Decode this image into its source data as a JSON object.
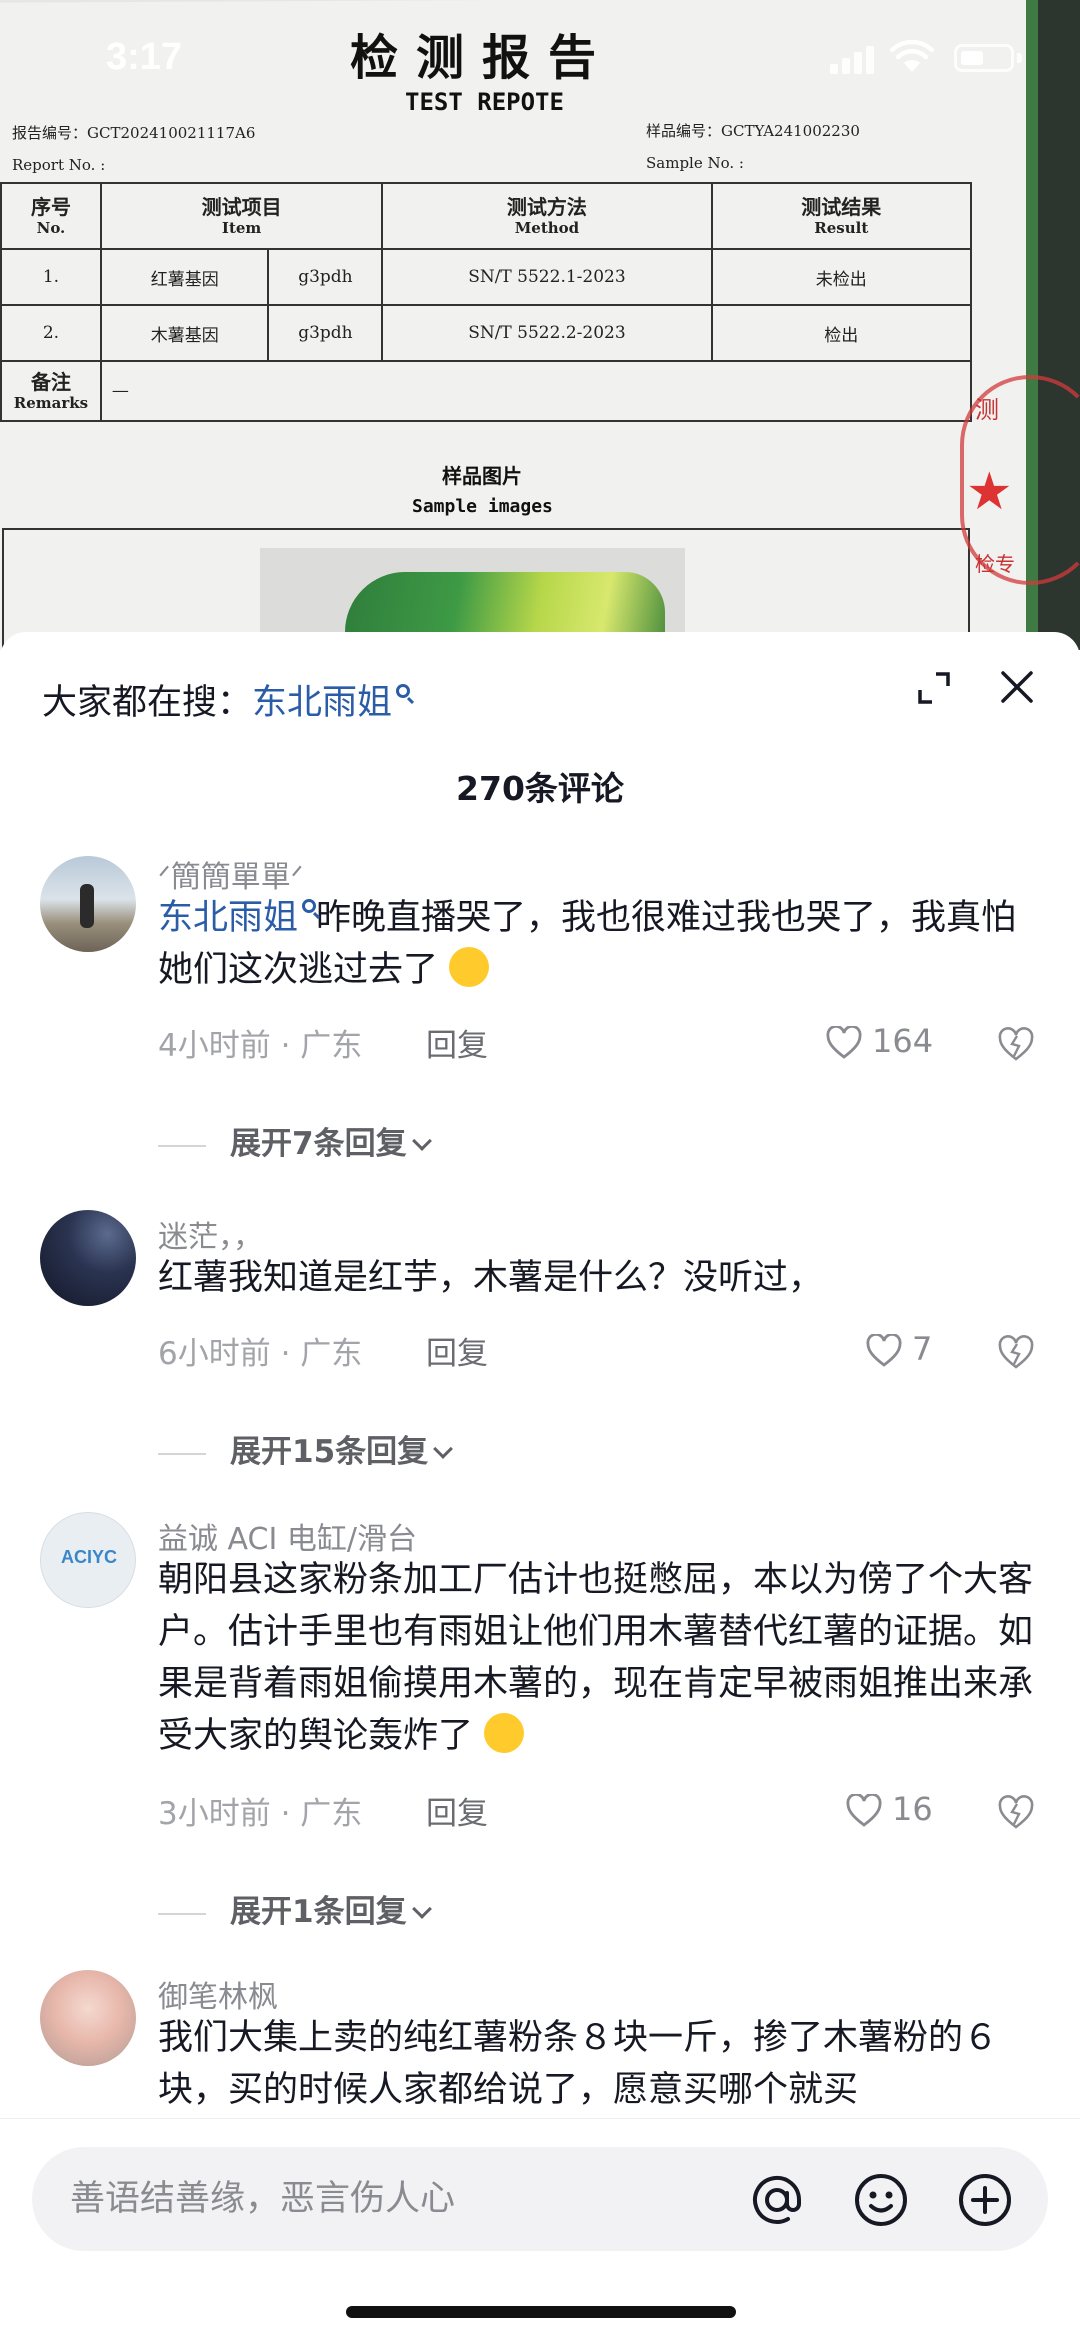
{
  "status_bar": {
    "time": "3:17"
  },
  "report": {
    "title": "检测报告",
    "subtitle": "TEST REPOTE",
    "report_no_label": "报告编号：",
    "report_no_en": "Report No. :",
    "report_no": "GCT202410021117A6",
    "sample_no_label": "样品编号：",
    "sample_no_en": "Sample No. :",
    "sample_no": "GCTYA241002230",
    "columns": [
      {
        "zh": "序号",
        "en": "No."
      },
      {
        "zh": "测试项目",
        "en": "Item"
      },
      {
        "zh": "测试方法",
        "en": "Method"
      },
      {
        "zh": "测试结果",
        "en": "Result"
      }
    ],
    "rows": [
      {
        "no": "1.",
        "item": "红薯基因",
        "gene": "g3pdh",
        "method": "SN/T 5522.1-2023",
        "result": "未检出"
      },
      {
        "no": "2.",
        "item": "木薯基因",
        "gene": "g3pdh",
        "method": "SN/T 5522.2-2023",
        "result": "检出"
      }
    ],
    "remarks_zh": "备注",
    "remarks_en": "Remarks",
    "remarks_value": "—",
    "sample_images_zh": "样品图片",
    "sample_images_en": "Sample images",
    "stamp_text_1": "测",
    "stamp_text_2": "检专"
  },
  "sheet": {
    "search_prefix": "大家都在搜：",
    "search_keyword": "东北雨姐",
    "comment_count": "270条评论"
  },
  "comments": [
    {
      "name": "ᐟ簡簡單單ᐟ",
      "keyword": "东北雨姐",
      "text": "昨晚直播哭了，我也很难过我也哭了，我真怕她们这次逃过去了",
      "time_location": "4小时前 · 广东",
      "reply": "回复",
      "likes": "164",
      "expand": "展开7条回复"
    },
    {
      "name": "迷茫，，",
      "text": "红薯我知道是红芋，木薯是什么？没听过，",
      "time_location": "6小时前 · 广东",
      "reply": "回复",
      "likes": "7",
      "expand": "展开15条回复"
    },
    {
      "name": "益诚 ACI 电缸/滑台",
      "avatar_logo": "ACIYC",
      "text": "朝阳县这家粉条加工厂估计也挺憋屈，本以为傍了个大客户。估计手里也有雨姐让他们用木薯替代红薯的证据。如果是背着雨姐偷摸用木薯的，现在肯定早被雨姐推出来承受大家的舆论轰炸了",
      "time_location": "3小时前 · 广东",
      "reply": "回复",
      "likes": "16",
      "expand": "展开1条回复"
    },
    {
      "name": "御笔林枫",
      "text": "我们大集上卖的纯红薯粉条８块一斤，掺了木薯粉的６块，买的时候人家都给说了，愿意买哪个就买"
    }
  ],
  "input": {
    "placeholder": "善语结善缘，恶言伤人心"
  },
  "icons": [
    "signal-icon",
    "wifi-icon",
    "battery-icon",
    "search-icon",
    "expand-icon",
    "close-icon",
    "heart-icon",
    "dislike-icon",
    "chevron-down-icon",
    "at-icon",
    "emoji-icon",
    "add-icon"
  ],
  "colors": {
    "keyword": "#2a5ca8",
    "stamp": "#d23b3b",
    "text": "#161823",
    "muted": "#8a8b91"
  }
}
